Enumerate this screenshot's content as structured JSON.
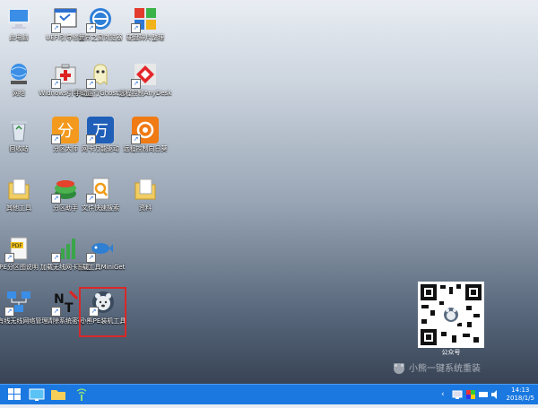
{
  "desktop": {
    "icons": [
      {
        "label": "此电脑",
        "icon": "computer-icon"
      },
      {
        "label": "UEFI引导修复",
        "icon": "uefi-window-icon"
      },
      {
        "label": "世界之窗浏览器",
        "icon": "globe-browser-icon"
      },
      {
        "label": "硬盘碎片整理",
        "icon": "defrag-cubes-icon"
      },
      {
        "label": "网络",
        "icon": "network-globe-icon"
      },
      {
        "label": "Widnows引导修复",
        "icon": "first-aid-kit-icon"
      },
      {
        "label": "手动运行Ghost12",
        "icon": "ghost-icon"
      },
      {
        "label": "远程控制AnyDesk",
        "icon": "anydesk-icon"
      },
      {
        "label": "回收站",
        "icon": "recycle-bin-icon"
      },
      {
        "label": "分区大师",
        "icon": "partition-master-icon"
      },
      {
        "label": "网卡万能驱动",
        "icon": "wan-driver-icon"
      },
      {
        "label": "远程控制向日葵",
        "icon": "sunflower-icon"
      },
      {
        "label": "其他工具",
        "icon": "folder-icon"
      },
      {
        "label": "分区助手",
        "icon": "partition-assistant-icon"
      },
      {
        "label": "文件快速搜索",
        "icon": "file-search-icon"
      },
      {
        "label": "资料",
        "icon": "folder-icon"
      },
      {
        "label": "PE分区图说明",
        "icon": "pdf-doc-icon"
      },
      {
        "label": "加载无线网卡驱动",
        "icon": "wifi-bars-icon"
      },
      {
        "label": "下载工具MiniGet",
        "icon": "fish-download-icon"
      },
      {
        "label": "PE有线无线网络管理",
        "icon": "network-manager-icon"
      },
      {
        "label": "清除系统密码",
        "icon": "ntpwd-icon"
      },
      {
        "label": "小熊PE装机工具",
        "icon": "bear-icon"
      }
    ],
    "qr_label": "公众号",
    "brand": "小熊一键系统重装"
  },
  "taskbar": {
    "time": "14:13",
    "date": "2018/1/5"
  }
}
